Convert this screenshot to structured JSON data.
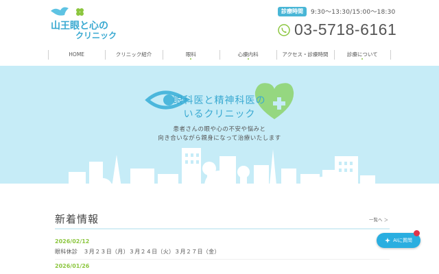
{
  "header": {
    "logo_line1": "山王眼と心の",
    "logo_line2": "クリニック",
    "hours_label": "診療時間",
    "hours_text": "9:30〜13:30/15:00〜18:30",
    "phone": "03-5718-6161"
  },
  "nav": {
    "items": [
      {
        "label": "HOME"
      },
      {
        "label": "クリニック紹介"
      },
      {
        "label": "眼科"
      },
      {
        "label": "心療内科"
      },
      {
        "label": "アクセス・診療時間"
      },
      {
        "label": "診療について"
      }
    ]
  },
  "hero": {
    "title_line1": "眼科医と精神科医の",
    "title_line2": "いるクリニック",
    "subtitle_line1": "患者さんの眼や心の不安や悩みと",
    "subtitle_line2": "向き合いながら親身になって治療いたします"
  },
  "news": {
    "heading": "新着情報",
    "more_label": "一覧へ ＞",
    "items": [
      {
        "date": "2026/02/12",
        "text": "眼科休診　３月２３日（月）３月２４日（火）３月２７日（金）"
      },
      {
        "date": "2026/01/26",
        "text": ""
      }
    ]
  },
  "ai_button": {
    "label": "AIに質問"
  },
  "colors": {
    "accent_blue": "#39a9d1",
    "accent_green": "#8cc63f",
    "hero_background": "#c6ecf7",
    "badge_red": "#e0344a"
  }
}
